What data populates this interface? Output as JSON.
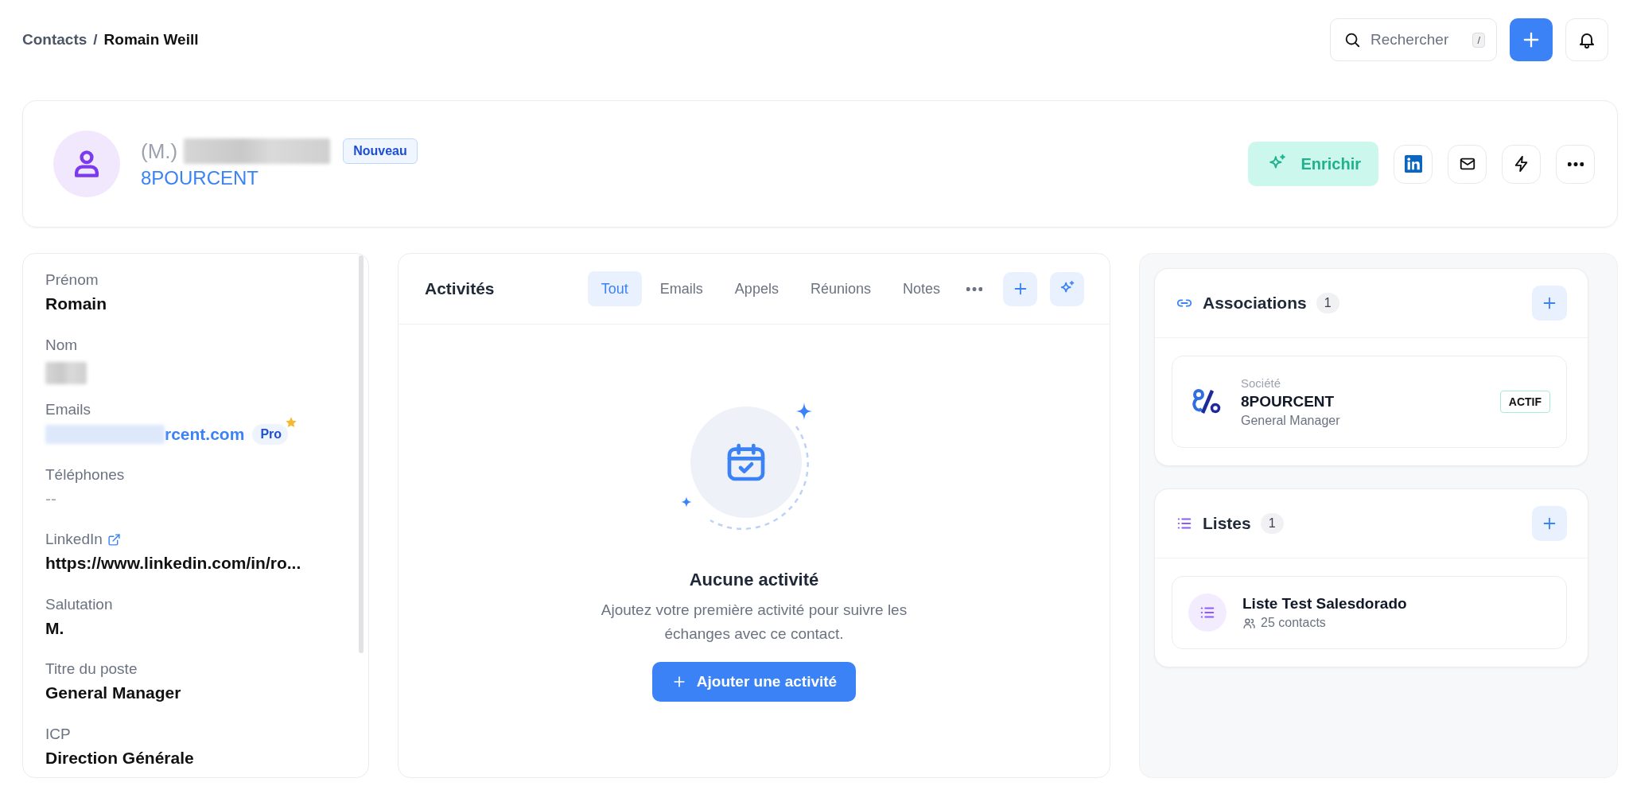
{
  "breadcrumb": {
    "parent": "Contacts",
    "separator": "/",
    "current": "Romain Weill"
  },
  "search": {
    "placeholder": "Rechercher",
    "shortcut": "/"
  },
  "contact": {
    "salutation": "(M.)",
    "name_redacted": true,
    "badge": "Nouveau",
    "company": "8POURCENT"
  },
  "actions": {
    "enrich": "Enrichir"
  },
  "fields": [
    {
      "label": "Prénom",
      "value": "Romain",
      "kind": "text"
    },
    {
      "label": "Nom",
      "kind": "redacted"
    },
    {
      "label": "Emails",
      "value": "rcent.com",
      "kind": "email",
      "badge": "Pro"
    },
    {
      "label": "Téléphones",
      "value": "--",
      "kind": "empty"
    },
    {
      "label": "LinkedIn",
      "value": "https://www.linkedin.com/in/ro...",
      "kind": "link"
    },
    {
      "label": "Salutation",
      "value": "M.",
      "kind": "text"
    },
    {
      "label": "Titre du poste",
      "value": "General Manager",
      "kind": "text"
    },
    {
      "label": "ICP",
      "value": "Direction Générale",
      "kind": "text"
    }
  ],
  "activities": {
    "title": "Activités",
    "tabs": [
      {
        "label": "Tout",
        "selected": true
      },
      {
        "label": "Emails",
        "selected": false
      },
      {
        "label": "Appels",
        "selected": false
      },
      {
        "label": "Réunions",
        "selected": false
      },
      {
        "label": "Notes",
        "selected": false
      }
    ],
    "empty": {
      "title": "Aucune activité",
      "text": "Ajoutez votre première activité pour suivre les échanges avec ce contact.",
      "button": "Ajouter une activité"
    }
  },
  "associations": {
    "title": "Associations",
    "count": "1",
    "items": [
      {
        "type": "Société",
        "name": "8POURCENT",
        "role": "General Manager",
        "status": "ACTIF"
      }
    ]
  },
  "lists": {
    "title": "Listes",
    "count": "1",
    "items": [
      {
        "name": "Liste Test Salesdorado",
        "members": "25 contacts"
      }
    ]
  }
}
